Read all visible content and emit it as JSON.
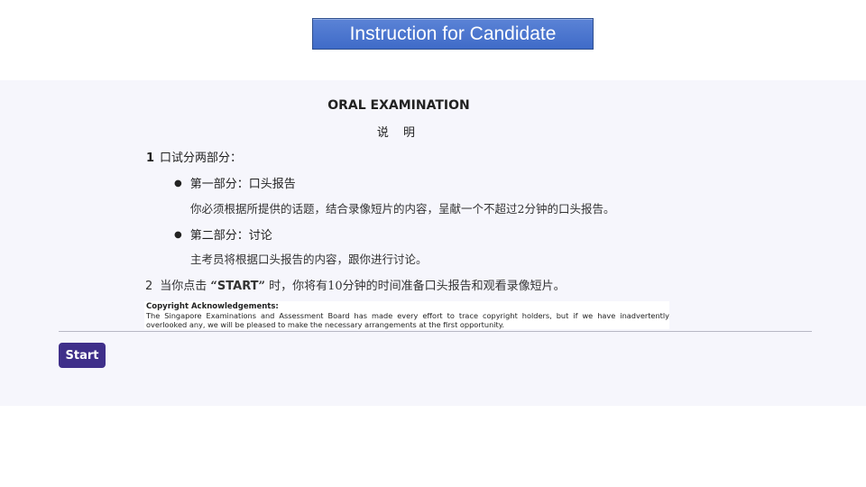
{
  "header": {
    "title": "Instruction for Candidate"
  },
  "content": {
    "title": "ORAL EXAMINATION",
    "subtitle": "说 明",
    "item1": {
      "number": "1",
      "text": "口试分两部分："
    },
    "part1": {
      "label": "第一部分：口头报告",
      "description": "你必须根据所提供的话题，结合录像短片的内容，呈献一个不超过2分钟的口头报告。"
    },
    "part2": {
      "label": "第二部分：讨论",
      "description": "主考员将根据口头报告的内容，跟你进行讨论。"
    },
    "item2": {
      "number": "2",
      "before": "当你点击 ",
      "open_quote": "“",
      "keyword": "START",
      "close_quote": "”",
      "after": " 时，你将有10分钟的时间准备口头报告和观看录像短片。"
    }
  },
  "copyright": {
    "title": "Copyright Acknowledgements:",
    "text": "The Singapore Examinations and Assessment Board has made every effort to trace copyright holders, but if we have inadvertently overlooked any, we will be pleased to make the necessary arrangements at the first opportunity."
  },
  "actions": {
    "start_label": "Start"
  },
  "colors": {
    "banner": "#4a74cf",
    "panel_background": "#f6f6fc",
    "start_button": "#3f2f8a"
  }
}
